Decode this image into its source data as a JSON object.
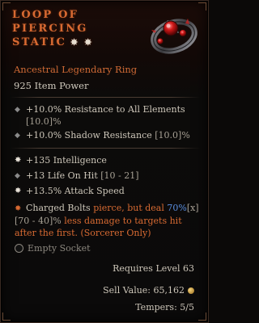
{
  "item": {
    "name_line1": "Loop of",
    "name_line2": "Piercing",
    "name_line3": "Static",
    "greater_marks": "✸ ✸",
    "type": "Ancestral Legendary Ring",
    "item_power": "925 Item Power"
  },
  "implicits": [
    {
      "text": "+10.0% Resistance to All Elements",
      "range": "[10.0]%"
    },
    {
      "text": "+10.0% Shadow Resistance",
      "range": "[10.0]%"
    }
  ],
  "affixes": [
    {
      "bullet": "✸",
      "text": "+135 Intelligence",
      "range": ""
    },
    {
      "bullet": "◆",
      "text": "+13 Life On Hit",
      "range": "[10 - 21]"
    },
    {
      "bullet": "✸",
      "text": "+13.5% Attack Speed",
      "range": ""
    }
  ],
  "aspect": {
    "bullet": "✸",
    "part1": "Charged Bolts",
    "part2": " pierce, but deal ",
    "value": "70%",
    "mult": "[x]",
    "range": "[70 - 40]%",
    "part3": " less damage to targets hit after the first. (Sorcerer Only)"
  },
  "socket": {
    "label": "Empty Socket"
  },
  "footer": {
    "requires": "Requires Level 63",
    "sell_value": "Sell Value: 65,162",
    "tempers": "Tempers: 5/5"
  },
  "colors": {
    "legendary": "#d86a32",
    "value_blue": "#5a8ee0",
    "text": "#cdc6b9"
  },
  "icons": [
    "ring-icon",
    "gold-coin-icon",
    "socket-icon",
    "greater-affix-star-icon"
  ]
}
